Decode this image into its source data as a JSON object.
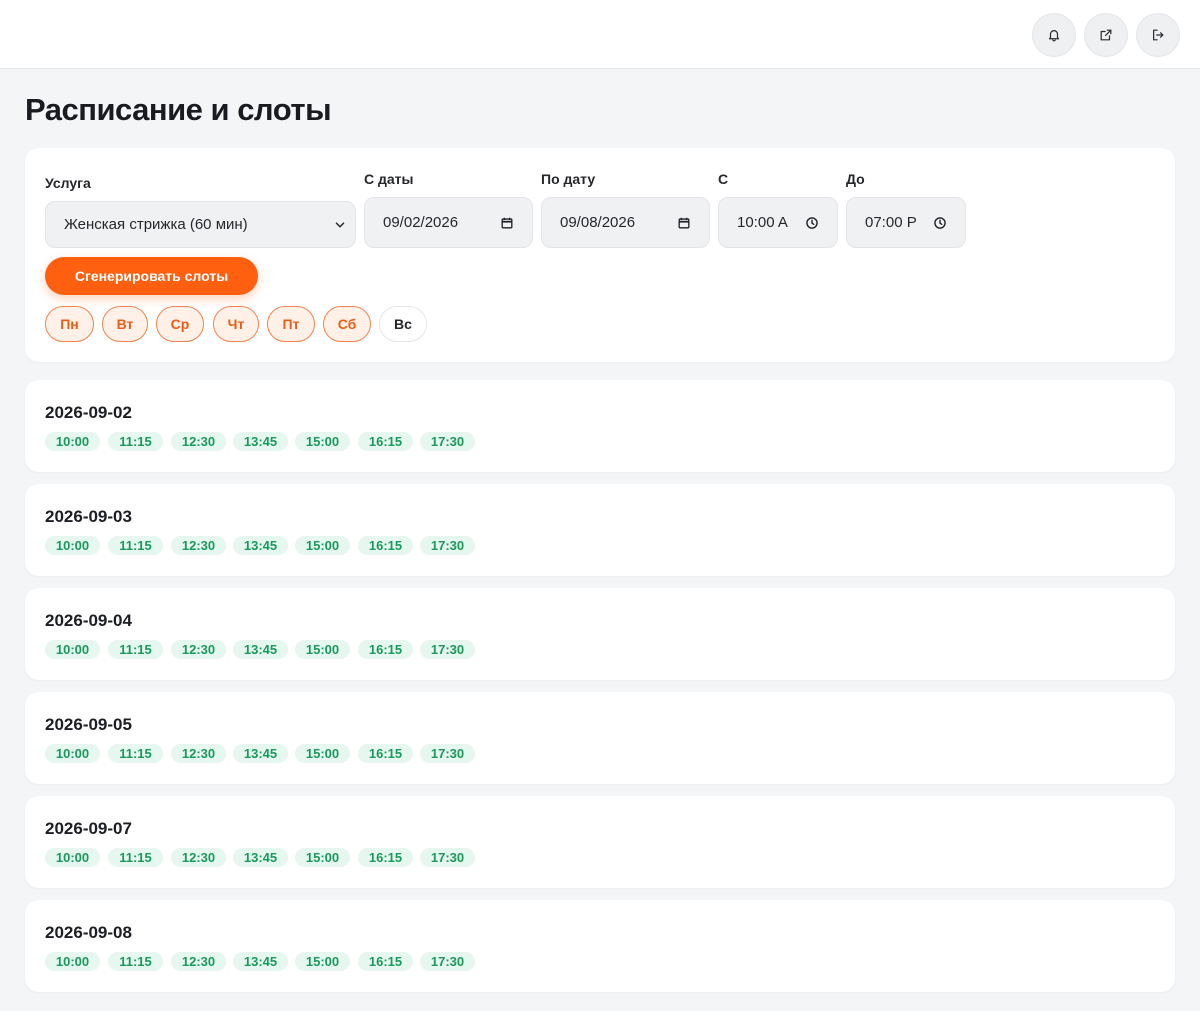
{
  "header": {
    "icons": [
      "bell-icon",
      "external-link-icon",
      "logout-icon"
    ]
  },
  "page": {
    "title": "Расписание и слоты"
  },
  "filters": {
    "service_label": "Услуга",
    "service_value": "Женская стрижка (60 мин)",
    "date_from_label": "С даты",
    "date_from_value": "09/02/2026",
    "date_to_label": "По дату",
    "date_to_value": "09/08/2026",
    "time_from_label": "С",
    "time_from_value": "10:00 A",
    "time_to_label": "До",
    "time_to_value": "07:00 P",
    "generate_label": "Сгенерировать слоты",
    "days": [
      {
        "label": "Пн",
        "active": true
      },
      {
        "label": "Вт",
        "active": true
      },
      {
        "label": "Ср",
        "active": true
      },
      {
        "label": "Чт",
        "active": true
      },
      {
        "label": "Пт",
        "active": true
      },
      {
        "label": "Сб",
        "active": true
      },
      {
        "label": "Вс",
        "active": false
      }
    ]
  },
  "schedule": [
    {
      "date": "2026-09-02",
      "slots": [
        "10:00",
        "11:15",
        "12:30",
        "13:45",
        "15:00",
        "16:15",
        "17:30"
      ]
    },
    {
      "date": "2026-09-03",
      "slots": [
        "10:00",
        "11:15",
        "12:30",
        "13:45",
        "15:00",
        "16:15",
        "17:30"
      ]
    },
    {
      "date": "2026-09-04",
      "slots": [
        "10:00",
        "11:15",
        "12:30",
        "13:45",
        "15:00",
        "16:15",
        "17:30"
      ]
    },
    {
      "date": "2026-09-05",
      "slots": [
        "10:00",
        "11:15",
        "12:30",
        "13:45",
        "15:00",
        "16:15",
        "17:30"
      ]
    },
    {
      "date": "2026-09-07",
      "slots": [
        "10:00",
        "11:15",
        "12:30",
        "13:45",
        "15:00",
        "16:15",
        "17:30"
      ]
    },
    {
      "date": "2026-09-08",
      "slots": [
        "10:00",
        "11:15",
        "12:30",
        "13:45",
        "15:00",
        "16:15",
        "17:30"
      ]
    }
  ],
  "colors": {
    "accent": "#ff6010",
    "slot_bg": "#e5f7ee",
    "slot_text": "#1a9a5c",
    "day_active_border": "#f4824a"
  }
}
